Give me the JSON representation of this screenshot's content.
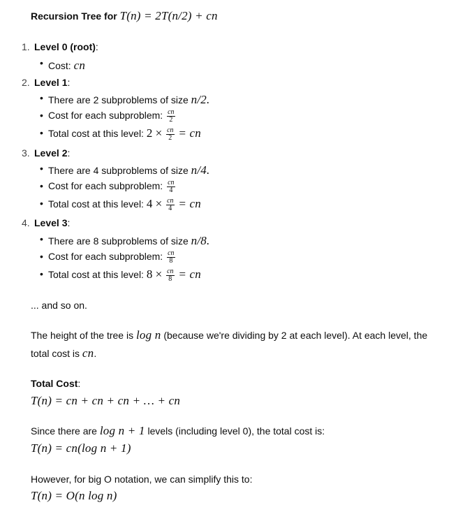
{
  "title": {
    "prefix": "Recursion Tree for",
    "formula": "T(n) = 2T(n/2) + cn"
  },
  "levels": [
    {
      "number": "1.",
      "heading": "Level 0 (root)",
      "cost_label": "Cost:",
      "cost_formula": "cn"
    },
    {
      "number": "2.",
      "heading": "Level 1",
      "subproblems_text": "There are 2 subproblems of size",
      "subproblem_size": "n/2.",
      "cost_each_label": "Cost for each subproblem:",
      "frac_num": "cn",
      "frac_den": "2",
      "total_label": "Total cost at this level:",
      "total_mult": "2 ×",
      "total_result": "= cn"
    },
    {
      "number": "3.",
      "heading": "Level 2",
      "subproblems_text": "There are 4 subproblems of size",
      "subproblem_size": "n/4.",
      "cost_each_label": "Cost for each subproblem:",
      "frac_num": "cn",
      "frac_den": "4",
      "total_label": "Total cost at this level:",
      "total_mult": "4 ×",
      "total_result": "= cn"
    },
    {
      "number": "4.",
      "heading": "Level 3",
      "subproblems_text": "There are 8 subproblems of size",
      "subproblem_size": "n/8.",
      "cost_each_label": "Cost for each subproblem:",
      "frac_num": "cn",
      "frac_den": "8",
      "total_label": "Total cost at this level:",
      "total_mult": "8 ×",
      "total_result": "= cn"
    }
  ],
  "and_so_on": "... and so on.",
  "height_para": {
    "part1": "The height of the tree is",
    "math1": "log n",
    "part2": "(because we're dividing by 2 at each level). At each level, the",
    "part3": "total cost is",
    "math2": "cn",
    "part4": "."
  },
  "total_cost": {
    "label": "Total Cost",
    "colon": ":",
    "formula": "T(n) = cn + cn + cn + … + cn"
  },
  "since_para": {
    "part1": "Since there are",
    "math1": "log n + 1",
    "part2": "levels (including level 0), the total cost is:",
    "formula": "T(n) = cn(log n + 1)"
  },
  "bigo_para": {
    "text": "However, for big O notation, we can simplify this to:",
    "formula": "T(n) = O(n log n)"
  }
}
